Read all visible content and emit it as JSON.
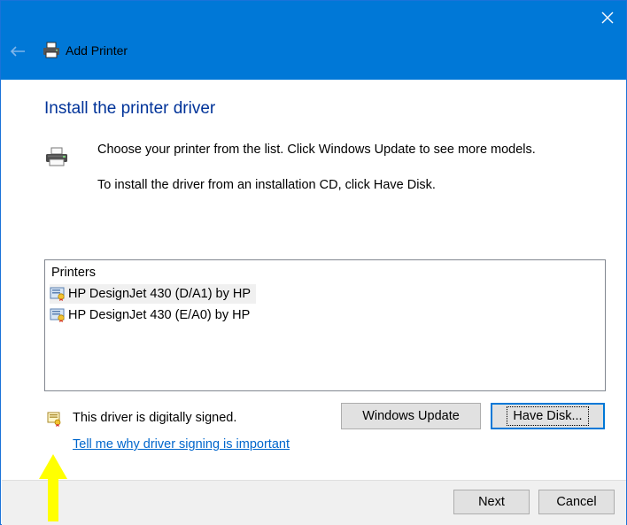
{
  "window": {
    "title": "Add Printer",
    "accent_color": "#0078d7",
    "icons": {
      "back": "back-arrow-icon",
      "close": "close-icon",
      "title": "printer-icon"
    }
  },
  "main": {
    "heading": "Install the printer driver",
    "description_line1": "Choose your printer from the list. Click Windows Update to see more models.",
    "description_line2": "To install the driver from an installation CD, click Have Disk."
  },
  "printers_list": {
    "header": "Printers",
    "items": [
      {
        "label": "HP DesignJet 430 (D/A1) by HP",
        "selected": true
      },
      {
        "label": "HP DesignJet 430 (E/A0) by HP",
        "selected": false
      }
    ]
  },
  "signing": {
    "status_text": "This driver is digitally signed.",
    "link_text": "Tell me why driver signing is important"
  },
  "buttons": {
    "windows_update": "Windows Update",
    "have_disk": "Have Disk...",
    "next": "Next",
    "cancel": "Cancel"
  },
  "annotation": {
    "arrow_color": "#ffff00"
  }
}
